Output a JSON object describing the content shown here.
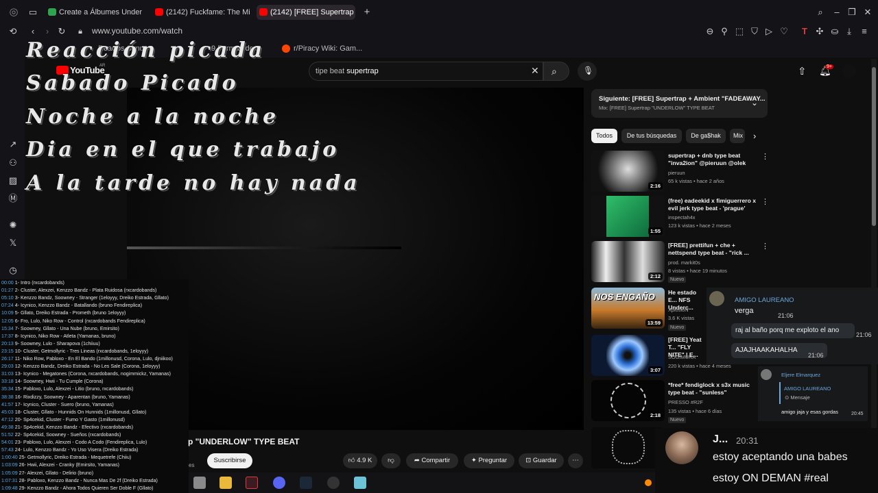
{
  "browser": {
    "tabs": [
      {
        "label": "Create a Álbumes Under A"
      },
      {
        "label": "(2142) Fuckfame: The Mix"
      },
      {
        "label": "(2142) [FREE] Supertrap \""
      }
    ],
    "new_tab": "+",
    "url": "www.youtube.com/watch",
    "bookmarks": [
      {
        "label": "Reac"
      },
      {
        "label": "os Simu"
      },
      {
        "label": "9 Formas de..."
      },
      {
        "label": "r/Piracy Wiki: Gam..."
      }
    ]
  },
  "youtube": {
    "logo": "YouTube",
    "logo_sup": "AR",
    "search_prefix": "tipe beat ",
    "search_query": "supertrap",
    "notif_count": "9+"
  },
  "overlay_lyrics": [
    "Reacción picada",
    "Sabado Picado",
    "Noche a la noche",
    "Dia en el que trabajo",
    "A la tarde no hay nada"
  ],
  "tracklist": [
    {
      "t": "00:00",
      "txt": "1- Intro (rxcardobands)"
    },
    {
      "t": "01:27",
      "txt": "2- Cluster, Alexzei, Kenzzo Bandz - Plata Ruidosa (rxcardobands)"
    },
    {
      "t": "05:10",
      "txt": "3- Kenzzo Bandz, Soowney - Stranger (1eloyyy, Dreiko Estrada, Gllato)"
    },
    {
      "t": "07:24",
      "txt": "4- Icynico, Kenzzo Bandz - Batallando (bruno Fendireplica)"
    },
    {
      "t": "10:09",
      "txt": "5- Gllato, Dreiko Estrada - Prometh (bruno 1eloyyy)"
    },
    {
      "t": "12:05",
      "txt": "6- Fro, Lulo, Niko Row - Control (rxcardobands Fendireplica)"
    },
    {
      "t": "15:34",
      "txt": "7- Soowney, Gllato - Una Nube (bruno, Emirsito)"
    },
    {
      "t": "17:37",
      "txt": "8- Icynico, Niko Row - Atleta (Yamanas, bruno)"
    },
    {
      "t": "20:13",
      "txt": "9- Soowney, Lulo - Sharapova (1chiiuu)"
    },
    {
      "t": "23:15",
      "txt": "10- Cluster, Getmollyric - Tres Lineas (rxcardobands, 1eloyyy)"
    },
    {
      "t": "26:17",
      "txt": "11- Niko Row, Pabloxo - En El Bando (1millonusd, Corona, Lulo, djniikoo)"
    },
    {
      "t": "29:03",
      "txt": "12- Kenzzo Bandz, Dreiko Estrada - No Les Sale (Corona, 1eloyyy)"
    },
    {
      "t": "31:03",
      "txt": "13- Icynico - Megatones (Corona, rxcardobands, nogimmickz, Yamanas)"
    },
    {
      "t": "33:18",
      "txt": "14- Soowney, Hwii - Tu Cumple (Corona)"
    },
    {
      "t": "35:34",
      "txt": "15- Pabloxo, Lulo, Alexzei - Litio (bruno, rxcardobands)"
    },
    {
      "t": "38:38",
      "txt": "16- Rixdizzy, Soowney - Aparentan (bruno, Yamanas)"
    },
    {
      "t": "41:57",
      "txt": "17- Icynico, Cluster - Suero (bruno, Yamanas)"
    },
    {
      "t": "45:03",
      "txt": "18- Cluster, Gllato - Hunnids On Hunnids (1millonusd, Gllato)"
    },
    {
      "t": "47:12",
      "txt": "20- Sp4cekid, Cluster - Fumo Y Gasto (1millonusd)"
    },
    {
      "t": "49:38",
      "txt": "21- Sp4cekid, Kenzzo Bandz - Efectivo (rxcardobands)"
    },
    {
      "t": "51:52",
      "txt": "22- Sp4cekid, Soowney - Sueños (rxcardobands)"
    },
    {
      "t": "54:01",
      "txt": "23- Pabloxo, Lulo, Alexzei - Codo A Codo (Fendireplica, Lulo)"
    },
    {
      "t": "57:43",
      "txt": "24- Lulo, Kenzzo Bandz - Yo Uso Visera (Dreiko Estrada)"
    },
    {
      "t": "1:00:40",
      "txt": "25- Getmollyric, Dreiko Estrada - Mequetrefe (Chiiu)"
    },
    {
      "t": "1:03:09",
      "txt": "26- Hwii, Alexzei - Cranky (Emirsito, Yamanas)"
    },
    {
      "t": "1:05:09",
      "txt": "27- Alexzei, Gllato - Delirio (bruno)"
    },
    {
      "t": "1:07:31",
      "txt": "28- Pabloxo, Kenzzo Bandz - Nunca Mas De 2f (Dreiko Estrada)"
    },
    {
      "t": "1:09:48",
      "txt": "29- Kenzzo Bandz - Ahora Todos Quieren Ser Doble F (Gllato)"
    }
  ],
  "video": {
    "title": "p \"UNDERLOW\" TYPE BEAT",
    "subscribe": "Suscribirse",
    "likes": "4.9 K",
    "share": "Compartir",
    "ask": "Preguntar",
    "save": "Guardar",
    "es_label": "es"
  },
  "up_next": {
    "title": "Siguiente: [FREE] Supertrap + Ambient \"FADEAWAY...",
    "subtitle": "Mix: [FREE] Supertrap \"UNDERLOW\" TYPE BEAT"
  },
  "chips": [
    {
      "label": "Todos"
    },
    {
      "label": "De tus búsquedas"
    },
    {
      "label": "De ga$hak"
    },
    {
      "label": "Mix"
    }
  ],
  "related": [
    {
      "title": "supertrap + dnb type beat \"inva2ion\" @pieruun @olek",
      "channel": "pieruun",
      "meta": "65 k vistas • hace 2 años",
      "duration": "2:16",
      "badge": ""
    },
    {
      "title": "(free) eadeekid x fimiguerrero x evil jerk type beat - 'prague'",
      "channel": "inspectah4x",
      "meta": "123 k vistas • hace 2 meses",
      "duration": "1:55",
      "badge": ""
    },
    {
      "title": "[FREE] prettifun + che + nettspend type beat - \"rick ...",
      "channel": "prod. markit0s",
      "meta": "8 vistas • hace 19 minutos",
      "duration": "2:12",
      "badge": "Nuevo"
    },
    {
      "title": "He estado E... NFS Underc...",
      "channel": "XplosioN",
      "meta": "3.6 K vistas",
      "duration": "13:59",
      "badge": "Nuevo",
      "thumb_text": "NOS ENGAÑO"
    },
    {
      "title": "[FREE] Yeat T... \"FLY NITE\" | E...",
      "channel": "SOGIMURA",
      "meta": "220 k vistas • hace 4 meses",
      "duration": "3:07",
      "badge": ""
    },
    {
      "title": "*free* fendiglock x s3x music type beat - \"sunless\"",
      "channel": "PRESSO #R2F",
      "meta": "135 vistas • hace 6 días",
      "duration": "2:18",
      "badge": "Nuevo"
    }
  ],
  "discord_chat": {
    "user": "AMIGO LAUREANO",
    "msg1": "verga",
    "time1": "21:06",
    "msg2": "raj al baño porq me exploto el ano",
    "time2": "21:06",
    "msg3": "AJAJHAAKAHALHA",
    "time3": "21:06",
    "reply_user": "Eljere Elmarquez",
    "reply_quote_user": "AMIGO LAUREANO",
    "reply_quote_msg": "Mensaje",
    "reply_msg": "amigo jaja y esas gordas",
    "reply_time": "20:45"
  },
  "stream_chat": {
    "name": "J...",
    "time": "20:31",
    "line1": "estoy aceptando una babes",
    "line2": "estoy ON DEMAN #real"
  },
  "colors": {
    "youtube_red": "#ff0000",
    "chat_blue": "#6fa8dc",
    "opera_red": "#e23b3b"
  }
}
